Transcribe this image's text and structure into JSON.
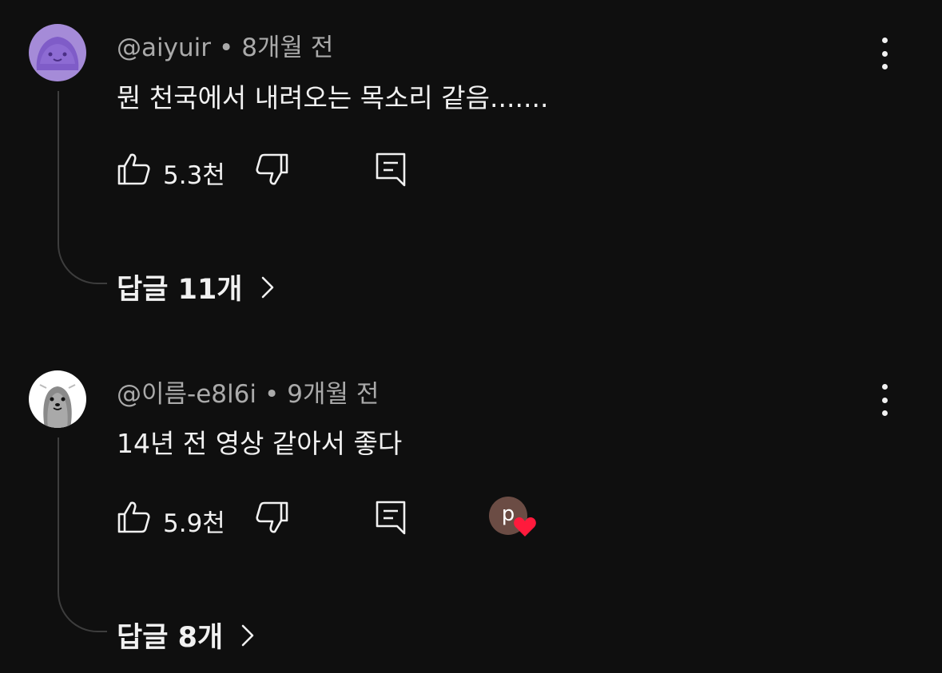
{
  "comments": [
    {
      "author": "@aiyuir",
      "separator": "•",
      "time": "8개월 전",
      "text": "뭔 천국에서 내려오는 목소리 같음.......",
      "likes": "5.3천",
      "replies_label": "답글 11개",
      "avatar_icon": "purple-blob-avatar-icon",
      "hearted": false
    },
    {
      "author": "@이름-e8l6i",
      "separator": "•",
      "time": "9개월 전",
      "text": "14년 전 영상 같아서 좋다",
      "likes": "5.9천",
      "replies_label": "답글 8개",
      "avatar_icon": "white-seal-avatar-icon",
      "hearted": true,
      "heart_avatar_letter": "p"
    }
  ],
  "colors": {
    "background": "#0f0f0f",
    "text_primary": "#f1f1f1",
    "text_secondary": "#aaaaaa",
    "heart": "#ff1a3c",
    "creator_avatar": "#6b4c44"
  }
}
